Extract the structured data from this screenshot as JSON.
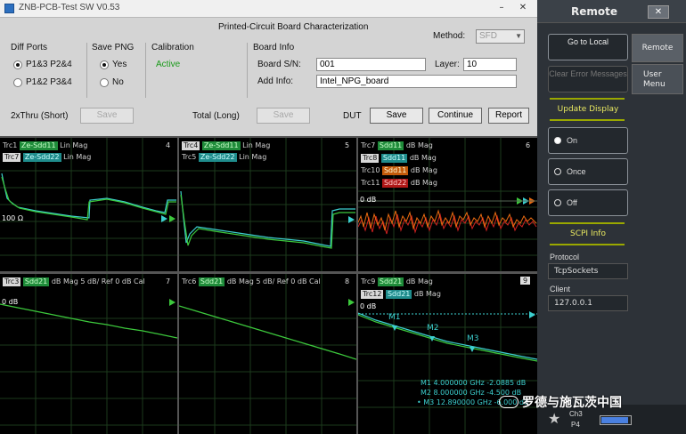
{
  "window": {
    "title": "ZNB-PCB-Test  SW  V0.53"
  },
  "form": {
    "heading": "Printed-Circuit Board Characterization",
    "method_label": "Method:",
    "method_value": "SFD",
    "diff_ports": {
      "label": "Diff Ports",
      "opt1": "P1&3 P2&4",
      "opt2": "P1&2 P3&4",
      "selected": "P1&3 P2&4"
    },
    "save_png": {
      "label": "Save PNG",
      "yes": "Yes",
      "no": "No",
      "selected": "Yes"
    },
    "calibration": {
      "label": "Calibration",
      "status": "Active"
    },
    "board_info": {
      "label": "Board Info",
      "sn_label": "Board S/N:",
      "sn_value": "001",
      "layer_label": "Layer:",
      "layer_value": "10",
      "addinfo_label": "Add Info:",
      "addinfo_value": "Intel_NPG_board"
    },
    "row": {
      "thru_label": "2xThru (Short)",
      "total_label": "Total (Long)",
      "dut_label": "DUT",
      "save": "Save",
      "continue": "Continue",
      "report": "Report"
    }
  },
  "panes": {
    "p4": {
      "num": "4",
      "t1": "Trc1",
      "t1tag": "Ze-Sdd11",
      "t1mode": "Lin Mag",
      "t2": "Trc7",
      "t2tag": "Ze-Sdd22",
      "t2mode": "Lin Mag",
      "ref": "100 Ω"
    },
    "p5": {
      "num": "5",
      "t1": "Trc4",
      "t1tag": "Ze-Sdd11",
      "t1mode": "Lin Mag",
      "t2": "Trc5",
      "t2tag": "Ze-Sdd22",
      "t2mode": "Lin Mag"
    },
    "p6": {
      "num": "6",
      "t1": "Trc7",
      "t1tag": "Sdd11",
      "t1mode": "dB Mag",
      "t2": "Trc8",
      "t2tag": "Sdd11",
      "t2mode": "dB Mag",
      "t3": "Trc10",
      "t3tag": "Sdd11",
      "t3mode": "dB Mag",
      "t4": "Trc11",
      "t4tag": "Sdd22",
      "t4mode": "dB Mag",
      "ref": "0 dB"
    },
    "p7": {
      "num": "7",
      "t1": "Trc3",
      "t1tag": "Sdd21",
      "t1mode": "dB Mag  5 dB/ Ref 0 dB  Cal",
      "ref": "0 dB"
    },
    "p8": {
      "num": "8",
      "t1": "Trc6",
      "t1tag": "Sdd21",
      "t1mode": "dB Mag  5 dB/ Ref 0 dB  Cal"
    },
    "p9": {
      "num": "9",
      "t1": "Trc9",
      "t1tag": "Sdd21",
      "t1mode": "dB Mag",
      "t2": "Trc12",
      "t2tag": "Sdd21",
      "t2mode": "dB Mag",
      "ref": "0 dB",
      "m1": "M1",
      "m2": "M2",
      "m3": "M3",
      "mk1": "M1   4.000000  GHz   -2.0885 dB",
      "mk2": "M2   8.000000  GHz   -4.500 dB",
      "mk3": "• M3  12.890000  GHz   -6.000 dB"
    }
  },
  "remote": {
    "title": "Remote",
    "close": "✕",
    "go_to_local": "Go to Local",
    "clear_errors": "Clear Error Messages",
    "tab_remote": "Remote",
    "tab_user_menu": "User Menu",
    "update_display": "Update Display",
    "on": "On",
    "once": "Once",
    "off": "Off",
    "selected": "On",
    "scpi_info": "SCPI Info",
    "protocol_label": "Protocol",
    "protocol_value": "TcpSockets",
    "client_label": "Client",
    "client_value": "127.0.0.1",
    "ch": "Ch3",
    "port": "P4"
  },
  "watermark": "罗德与施瓦茨中国",
  "colors": {
    "trace_green": "#3cc83c",
    "trace_cyan": "#3ccfcf",
    "trace_orange": "#e86a10",
    "trace_red": "#d02020",
    "grid": "#2a4a2a"
  }
}
